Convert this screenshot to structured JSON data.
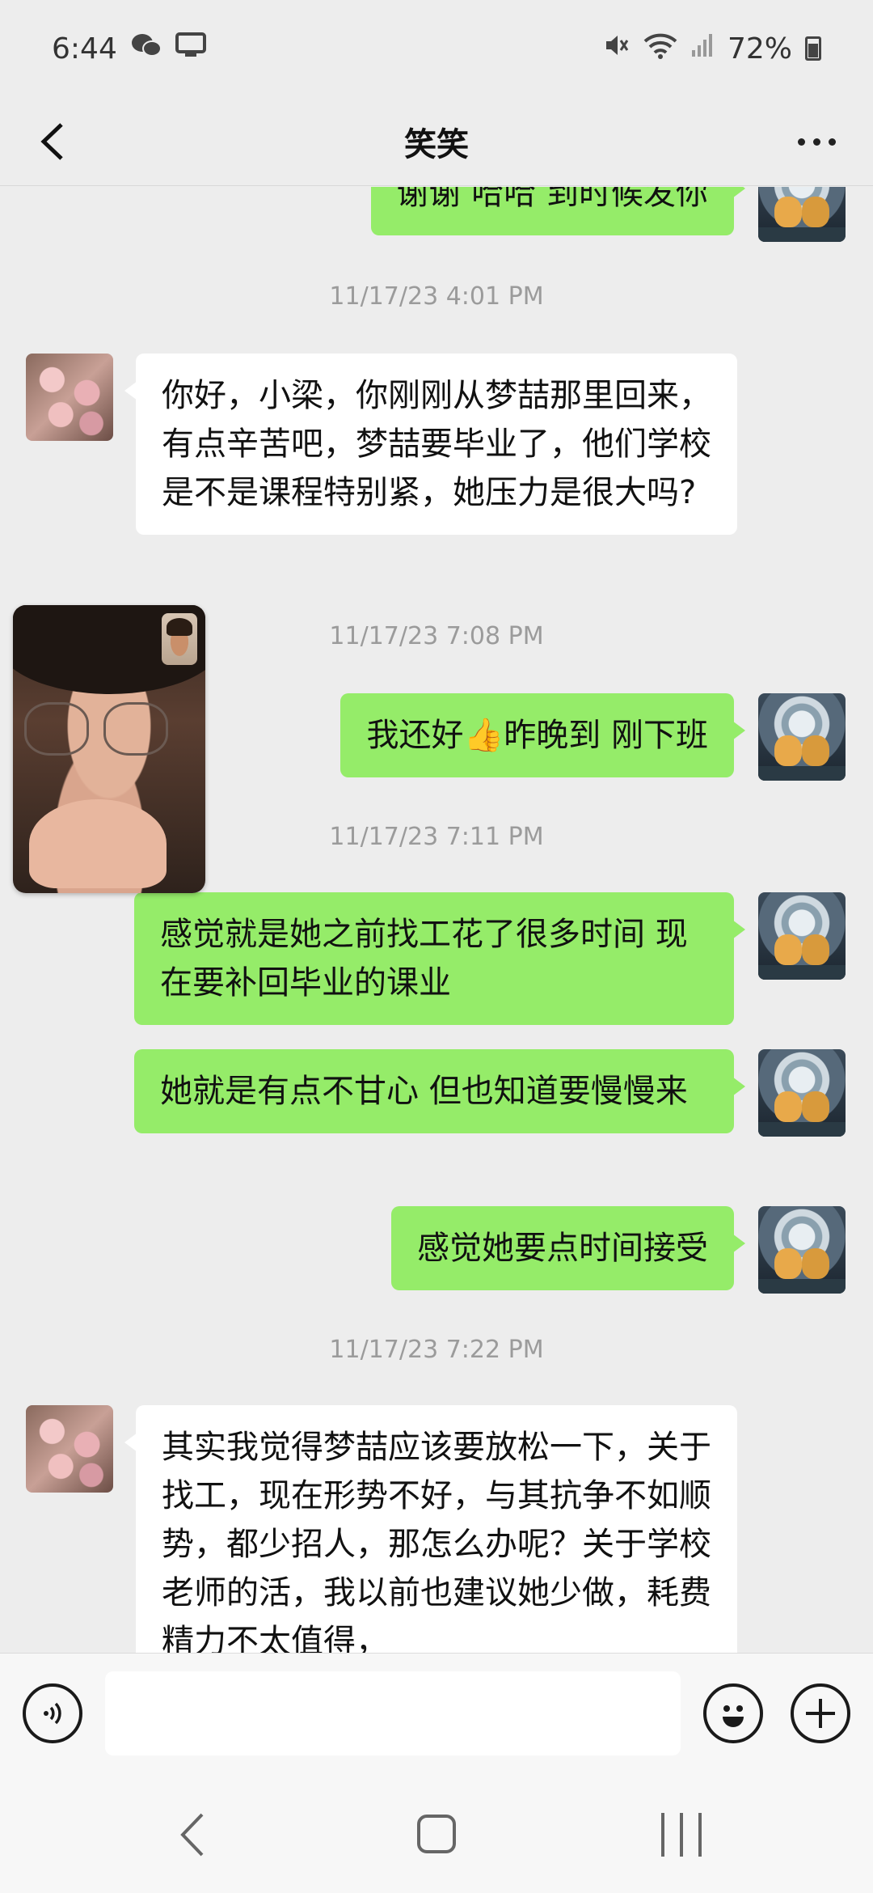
{
  "status_bar": {
    "time": "6:44",
    "battery_text": "72%",
    "icons": [
      "wechat-icon",
      "screen-icon",
      "mute-icon",
      "wifi-icon",
      "signal-icon",
      "battery-icon"
    ]
  },
  "header": {
    "title": "笑笑",
    "back_icon": "chevron-left-icon",
    "more_icon": "more-icon"
  },
  "messages": [
    {
      "type": "out",
      "text": "谢谢 哈哈 到时候发你"
    },
    {
      "type": "time",
      "text": "11/17/23 4:01 PM"
    },
    {
      "type": "in",
      "text": "你好，小梁，你刚刚从梦喆那里回来，有点辛苦吧，梦喆要毕业了，他们学校是不是课程特别紧，她压力是很大吗?"
    },
    {
      "type": "time",
      "text": "11/17/23 7:08 PM"
    },
    {
      "type": "out",
      "text": "我还好👍昨晚到 刚下班"
    },
    {
      "type": "time",
      "text": "11/17/23 7:11 PM"
    },
    {
      "type": "out",
      "text": "感觉就是她之前找工花了很多时间 现在要补回毕业的课业"
    },
    {
      "type": "out",
      "text": "她就是有点不甘心 但也知道要慢慢来"
    },
    {
      "type": "out",
      "text": "感觉她要点时间接受"
    },
    {
      "type": "time",
      "text": "11/17/23 7:22 PM"
    },
    {
      "type": "in",
      "text": "其实我觉得梦喆应该要放松一下，关于找工，现在形势不好，与其抗争不如顺势，都少招人，那怎么办呢？关于学校老师的活，我以前也建议她少做，耗费精力不太值得，"
    }
  ],
  "input_bar": {
    "placeholder": "",
    "voice_icon": "voice-icon",
    "emoji_icon": "emoji-icon",
    "plus_icon": "plus-icon"
  },
  "nav_bar": {
    "icons": [
      "nav-back-icon",
      "nav-home-icon",
      "nav-recents-icon"
    ]
  },
  "colors": {
    "background": "#ededed",
    "outgoing_bubble": "#95ec69",
    "incoming_bubble": "#ffffff",
    "timestamp": "#9b9b9b"
  }
}
